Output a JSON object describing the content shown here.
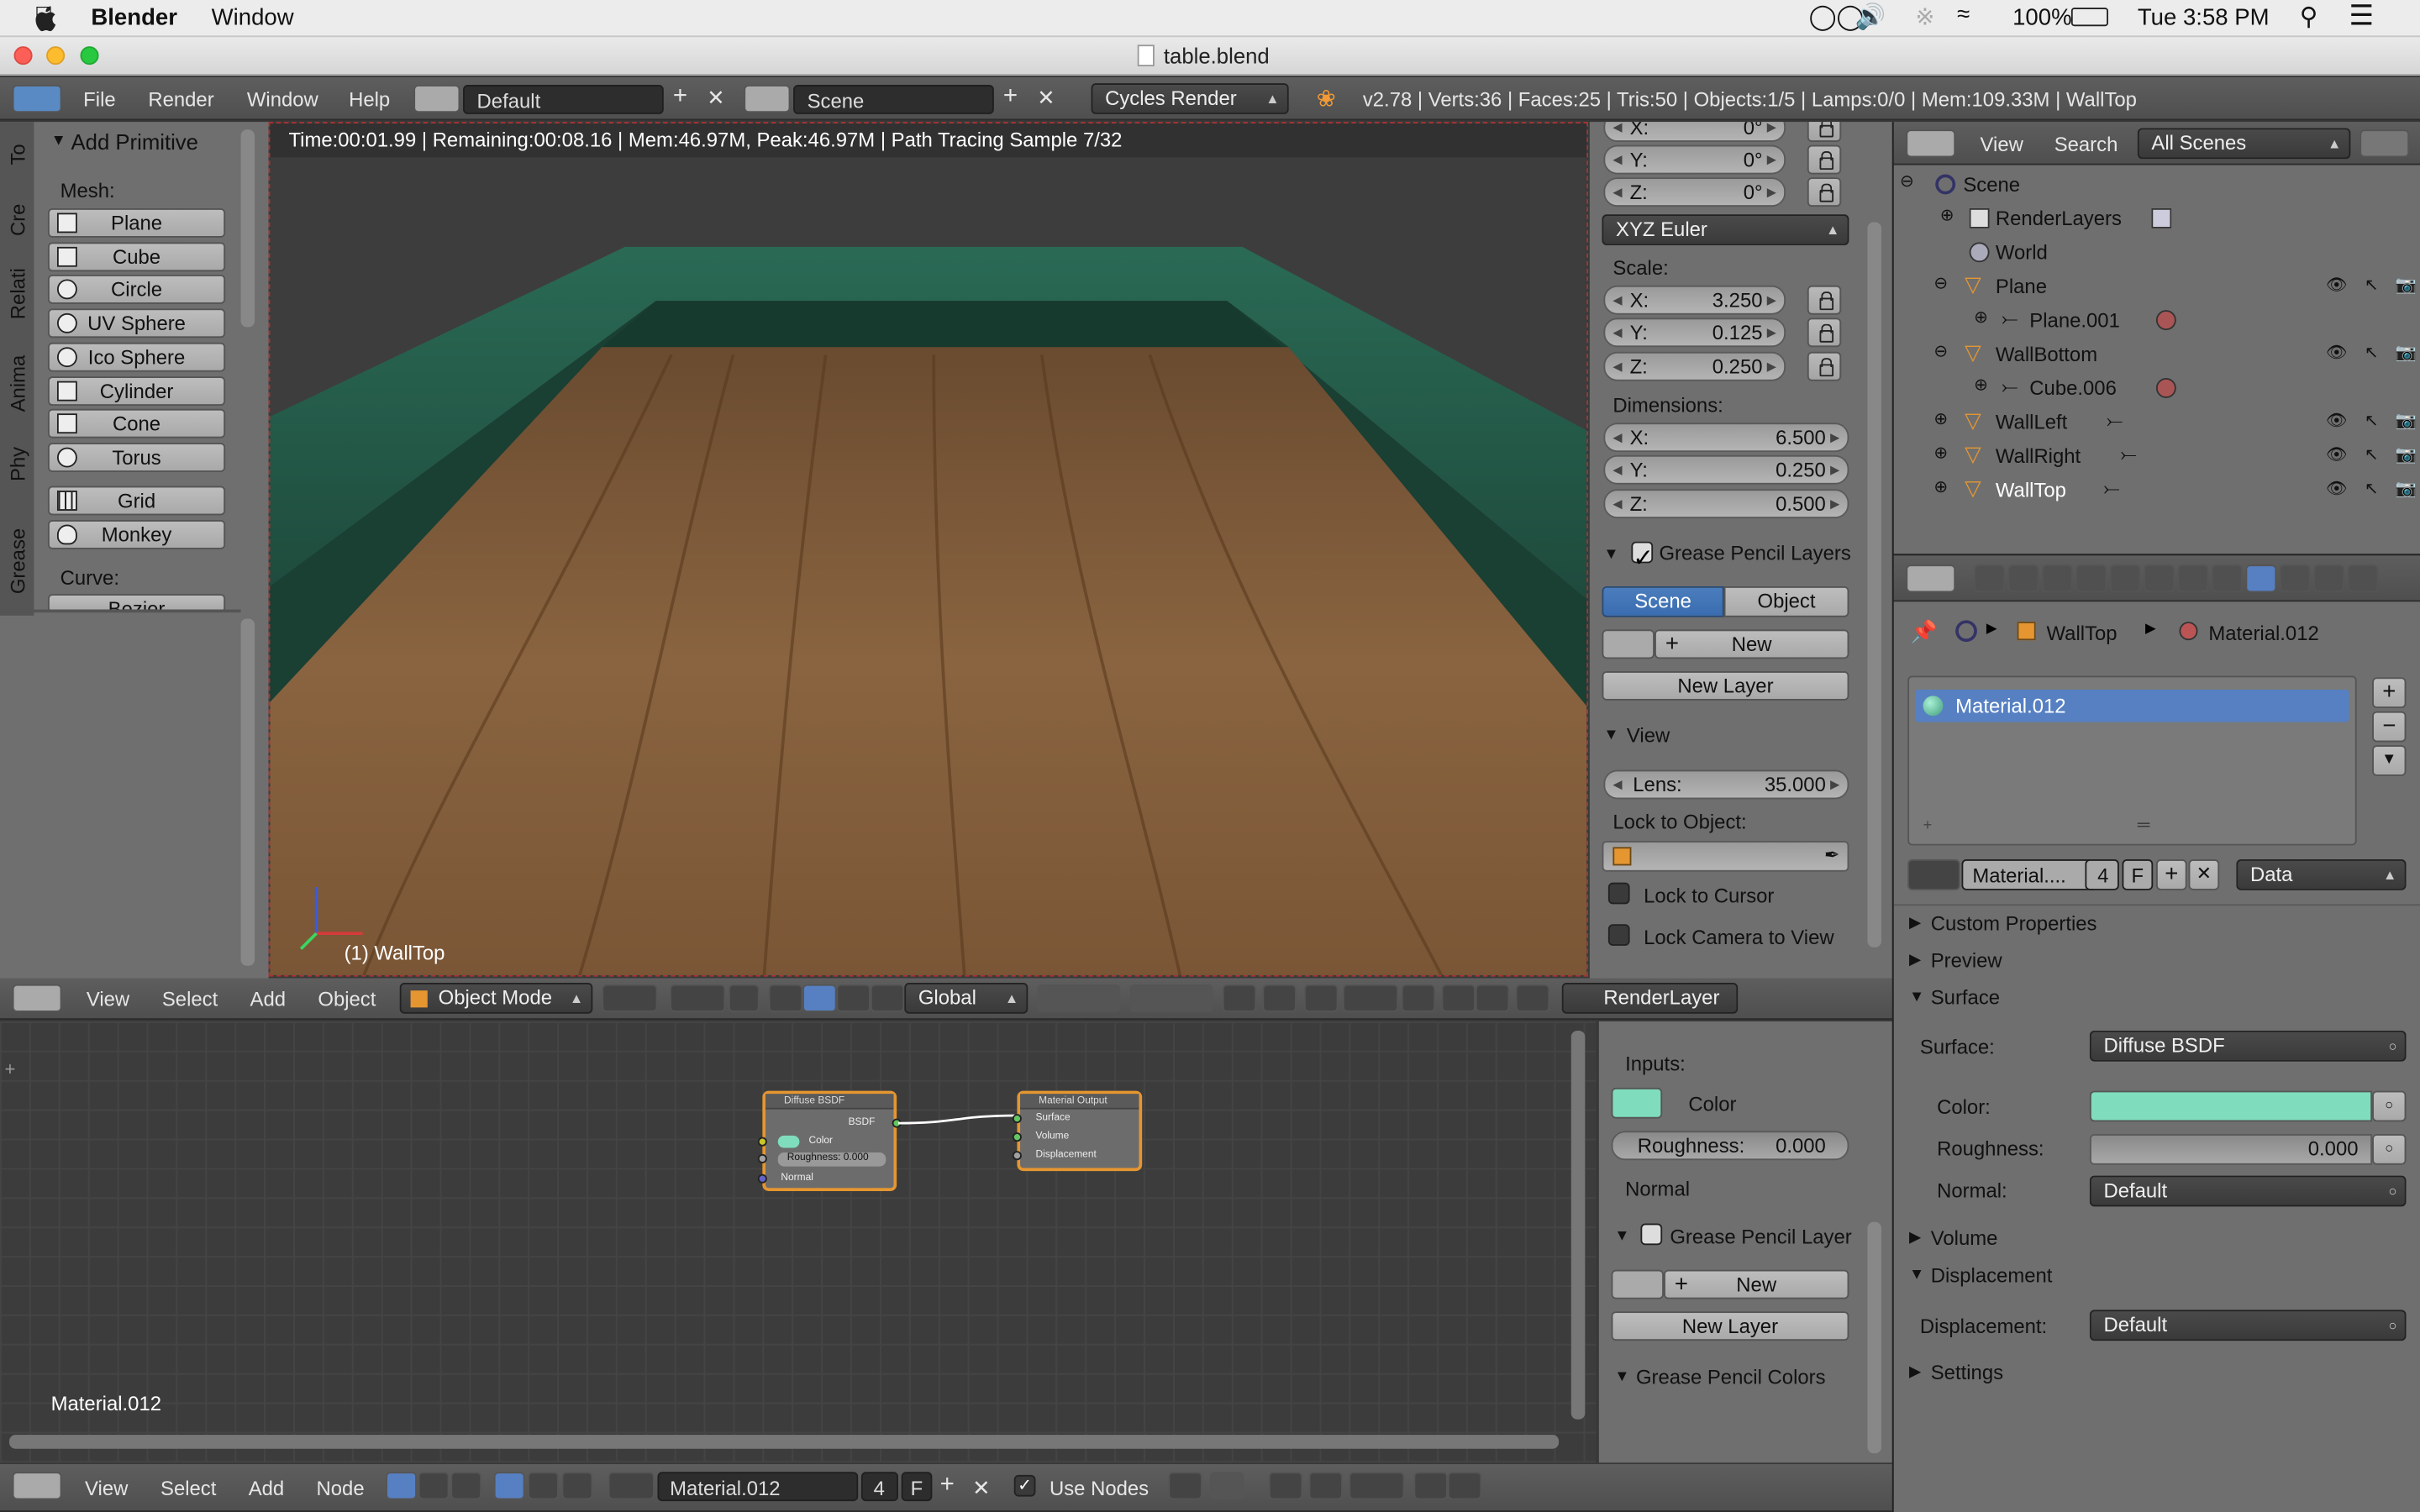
{
  "macos": {
    "app": "Blender",
    "menu_window": "Window",
    "battery": "100%",
    "clock": "Tue 3:58 PM"
  },
  "window": {
    "title": "table.blend"
  },
  "info_header": {
    "file": "File",
    "render": "Render",
    "window": "Window",
    "help": "Help",
    "layout": "Default",
    "scene": "Scene",
    "engine": "Cycles Render",
    "stats": "v2.78 | Verts:36 | Faces:25 | Tris:50 | Objects:1/5 | Lamps:0/0 | Mem:109.33M | WallTop"
  },
  "toolshelf": {
    "tabs": [
      "To",
      "Cre",
      "Relati",
      "Anima",
      "Phy",
      "Grease"
    ],
    "title": "Add Primitive",
    "mesh_label": "Mesh:",
    "mesh_items": [
      "Plane",
      "Cube",
      "Circle",
      "UV Sphere",
      "Ico Sphere",
      "Cylinder",
      "Cone",
      "Torus"
    ],
    "grid": "Grid",
    "monkey": "Monkey",
    "curve_label": "Curve:",
    "bezier": "Bezier"
  },
  "viewport": {
    "render_status": "Time:00:01.99 | Remaining:00:08.16 | Mem:46.97M, Peak:46.97M | Path Tracing Sample 7/32",
    "object_label": "(1) WallTop"
  },
  "n_panel": {
    "rot_x_label": "X:",
    "rot_x_value": "0°",
    "rot_y_label": "Y:",
    "rot_y_value": "0°",
    "rot_z_label": "Z:",
    "rot_z_value": "0°",
    "rotation_mode": "XYZ Euler",
    "scale_label": "Scale:",
    "scale_x": "3.250",
    "scale_y": "0.125",
    "scale_z": "0.250",
    "dimensions_label": "Dimensions:",
    "dim_x": "6.500",
    "dim_y": "0.250",
    "dim_z": "0.500",
    "x": "X:",
    "y": "Y:",
    "z": "Z:",
    "grease_title": "Grease Pencil Layers",
    "scene_btn": "Scene",
    "object_btn": "Object",
    "new_btn": "New",
    "new_layer": "New Layer",
    "view_title": "View",
    "lens_label": "Lens:",
    "lens_value": "35.000",
    "lock_obj": "Lock to Object:",
    "lock_cursor": "Lock to Cursor",
    "lock_camera": "Lock Camera to View"
  },
  "view3d_header": {
    "view": "View",
    "select": "Select",
    "add": "Add",
    "object": "Object",
    "mode": "Object Mode",
    "orientation": "Global",
    "render_layer": "RenderLayer"
  },
  "node_editor": {
    "material_label": "Material.012",
    "diffuse": {
      "title": "Diffuse BSDF",
      "out": "BSDF",
      "color": "Color",
      "roughness": "Roughness: 0.000",
      "normal": "Normal"
    },
    "output": {
      "title": "Material Output",
      "surface": "Surface",
      "volume": "Volume",
      "displacement": "Displacement"
    }
  },
  "node_side": {
    "inputs": "Inputs:",
    "color": "Color",
    "roughness_label": "Roughness:",
    "roughness_value": "0.000",
    "normal": "Normal",
    "grease_title": "Grease Pencil Layer",
    "new_btn": "New",
    "new_layer": "New Layer",
    "grease_colors": "Grease Pencil Colors"
  },
  "node_header": {
    "view": "View",
    "select": "Select",
    "add": "Add",
    "node": "Node",
    "material": "Material.012",
    "users": "4",
    "fake": "F",
    "use_nodes": "Use Nodes"
  },
  "outliner": {
    "view": "View",
    "search": "Search",
    "filter": "All Scenes",
    "items": {
      "scene": "Scene",
      "renderlayers": "RenderLayers",
      "world": "World",
      "plane": "Plane",
      "plane001": "Plane.001",
      "wallbottom": "WallBottom",
      "cube006": "Cube.006",
      "wallleft": "WallLeft",
      "wallright": "WallRight",
      "walltop": "WallTop"
    }
  },
  "properties": {
    "bc_object": "WallTop",
    "bc_material": "Material.012",
    "slot": "Material.012",
    "mat_field": "Material....",
    "users": "4",
    "fake": "F",
    "link": "Data",
    "custom_properties": "Custom Properties",
    "preview": "Preview",
    "surface_section": "Surface",
    "surface_label": "Surface:",
    "surface_value": "Diffuse BSDF",
    "color_label": "Color:",
    "roughness_label": "Roughness:",
    "roughness_value": "0.000",
    "normal_label": "Normal:",
    "normal_value": "Default",
    "volume": "Volume",
    "displacement_section": "Displacement",
    "displacement_label": "Displacement:",
    "displacement_value": "Default",
    "settings": "Settings"
  },
  "colors": {
    "diffuse_color": "#7fdcbc",
    "selection": "#5680c2",
    "node_border": "#e59631"
  }
}
